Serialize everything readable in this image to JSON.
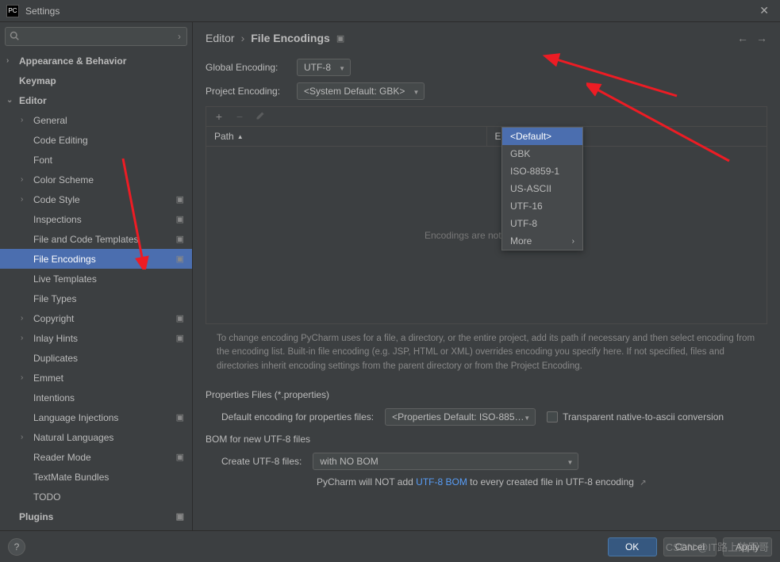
{
  "window": {
    "title": "Settings",
    "logo_text": "PC"
  },
  "search": {
    "placeholder": ""
  },
  "tree": {
    "items": [
      {
        "label": "Appearance & Behavior",
        "depth": 0,
        "chev": "›",
        "bold": true
      },
      {
        "label": "Keymap",
        "depth": 0,
        "chev": "",
        "bold": true
      },
      {
        "label": "Editor",
        "depth": 0,
        "chev": "⌄",
        "bold": true
      },
      {
        "label": "General",
        "depth": 1,
        "chev": "›"
      },
      {
        "label": "Code Editing",
        "depth": 1,
        "chev": ""
      },
      {
        "label": "Font",
        "depth": 1,
        "chev": ""
      },
      {
        "label": "Color Scheme",
        "depth": 1,
        "chev": "›"
      },
      {
        "label": "Code Style",
        "depth": 1,
        "chev": "›",
        "modified": true
      },
      {
        "label": "Inspections",
        "depth": 1,
        "chev": "",
        "modified": true
      },
      {
        "label": "File and Code Templates",
        "depth": 1,
        "chev": "",
        "modified": true
      },
      {
        "label": "File Encodings",
        "depth": 1,
        "chev": "",
        "modified": true,
        "selected": true
      },
      {
        "label": "Live Templates",
        "depth": 1,
        "chev": ""
      },
      {
        "label": "File Types",
        "depth": 1,
        "chev": ""
      },
      {
        "label": "Copyright",
        "depth": 1,
        "chev": "›",
        "modified": true
      },
      {
        "label": "Inlay Hints",
        "depth": 1,
        "chev": "›",
        "modified": true
      },
      {
        "label": "Duplicates",
        "depth": 1,
        "chev": ""
      },
      {
        "label": "Emmet",
        "depth": 1,
        "chev": "›"
      },
      {
        "label": "Intentions",
        "depth": 1,
        "chev": ""
      },
      {
        "label": "Language Injections",
        "depth": 1,
        "chev": "",
        "modified": true
      },
      {
        "label": "Natural Languages",
        "depth": 1,
        "chev": "›"
      },
      {
        "label": "Reader Mode",
        "depth": 1,
        "chev": "",
        "modified": true
      },
      {
        "label": "TextMate Bundles",
        "depth": 1,
        "chev": ""
      },
      {
        "label": "TODO",
        "depth": 1,
        "chev": ""
      },
      {
        "label": "Plugins",
        "depth": 0,
        "chev": "",
        "bold": true,
        "modified": true
      }
    ]
  },
  "breadcrumb": {
    "parent": "Editor",
    "current": "File Encodings"
  },
  "form": {
    "global_label": "Global Encoding:",
    "global_value": "UTF-8",
    "project_label": "Project Encoding:",
    "project_value": "<System Default: GBK>"
  },
  "popup": {
    "items": [
      {
        "label": "<Default>",
        "selected": true
      },
      {
        "label": "GBK"
      },
      {
        "label": "ISO-8859-1"
      },
      {
        "label": "US-ASCII"
      },
      {
        "label": "UTF-16"
      },
      {
        "label": "UTF-8"
      },
      {
        "label": "More",
        "more": true
      }
    ]
  },
  "table": {
    "col1": "Path",
    "col2": "Encoding",
    "empty_text": "Encodings are not configured"
  },
  "help_text": "To change encoding PyCharm uses for a file, a directory, or the entire project, add its path if necessary and then select encoding from the encoding list. Built-in file encoding (e.g. JSP, HTML or XML) overrides encoding you specify here. If not specified, files and directories inherit encoding settings from the parent directory or from the Project Encoding.",
  "properties": {
    "title": "Properties Files (*.properties)",
    "label": "Default encoding for properties files:",
    "value": "<Properties Default: ISO-885…",
    "checkbox_label": "Transparent native-to-ascii conversion"
  },
  "bom": {
    "title": "BOM for new UTF-8 files",
    "label": "Create UTF-8 files:",
    "value": "with NO BOM",
    "note_pre": "PyCharm will NOT add ",
    "note_link": "UTF-8 BOM",
    "note_post": " to every created file in UTF-8 encoding"
  },
  "footer": {
    "ok": "OK",
    "cancel": "Cancel",
    "apply": "Apply"
  },
  "watermark": "CSDN @IT路上的军哥"
}
